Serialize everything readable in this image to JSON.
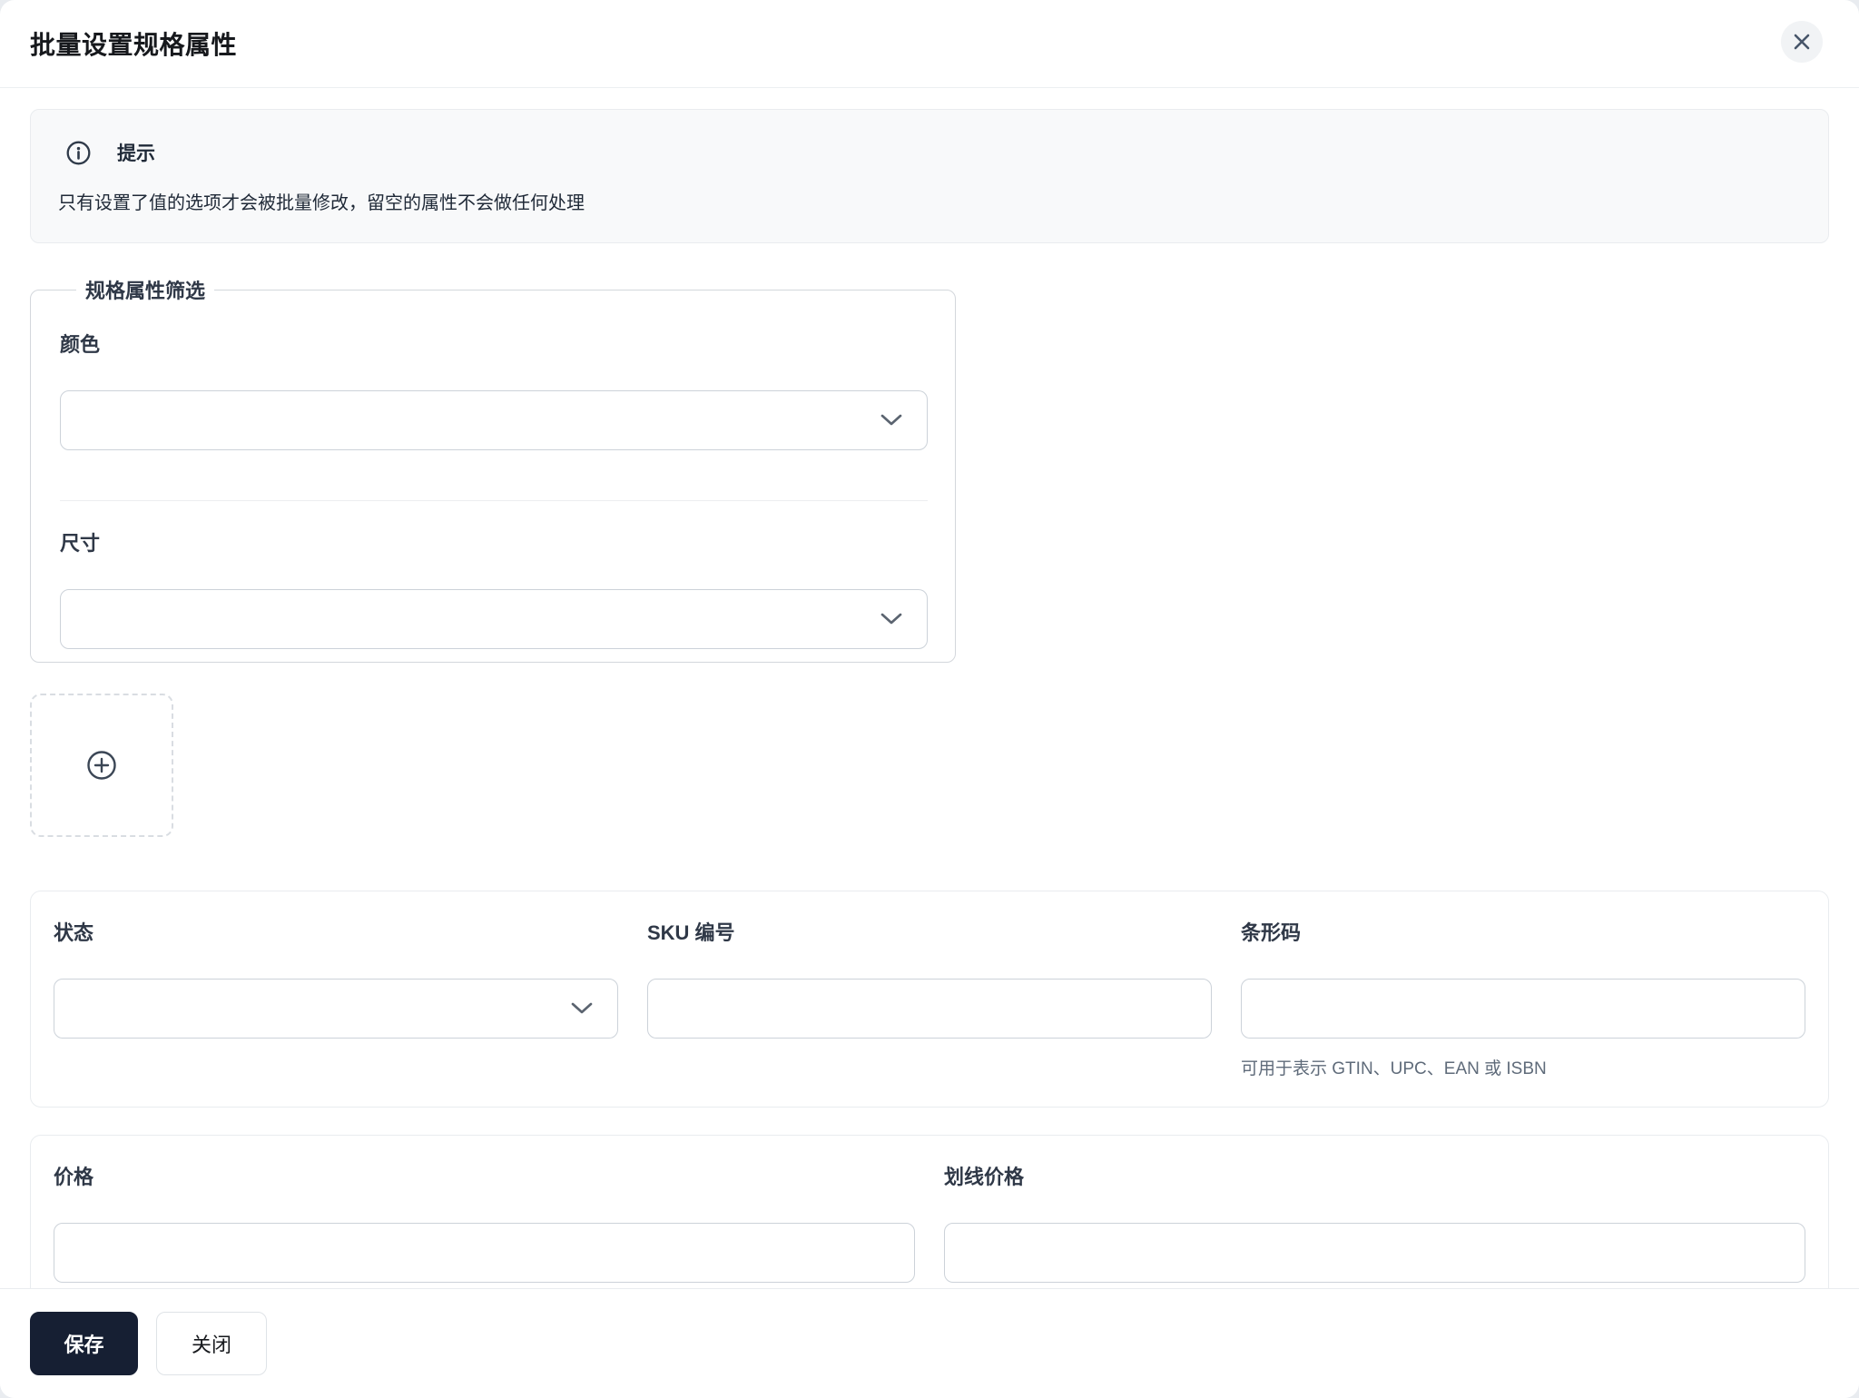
{
  "modal": {
    "title": "批量设置规格属性"
  },
  "notice": {
    "title": "提示",
    "description": "只有设置了值的选项才会被批量修改，留空的属性不会做任何处理"
  },
  "filter_group": {
    "legend": "规格属性筛选",
    "fields": [
      {
        "label": "颜色",
        "value": ""
      },
      {
        "label": "尺寸",
        "value": ""
      }
    ]
  },
  "attributes": {
    "status": {
      "label": "状态",
      "value": ""
    },
    "sku": {
      "label": "SKU 编号",
      "value": ""
    },
    "barcode": {
      "label": "条形码",
      "value": "",
      "helper": "可用于表示 GTIN、UPC、EAN 或 ISBN"
    }
  },
  "pricing": {
    "price": {
      "label": "价格",
      "value": ""
    },
    "compare_at_price": {
      "label": "划线价格",
      "value": ""
    }
  },
  "footer": {
    "save_label": "保存",
    "close_label": "关闭"
  },
  "colors": {
    "primary_button": "#161f33",
    "text_dark": "#17191d",
    "label": "#2f3847",
    "helper_text": "#5f6b7a",
    "notice_background": "#f8f9fa",
    "input_border": "#ccd2d9",
    "card_border": "#e9ecef"
  },
  "icons": {
    "close": "close-icon",
    "info": "info-icon",
    "chevron": "chevron-down-icon",
    "add": "plus-circle-icon"
  }
}
